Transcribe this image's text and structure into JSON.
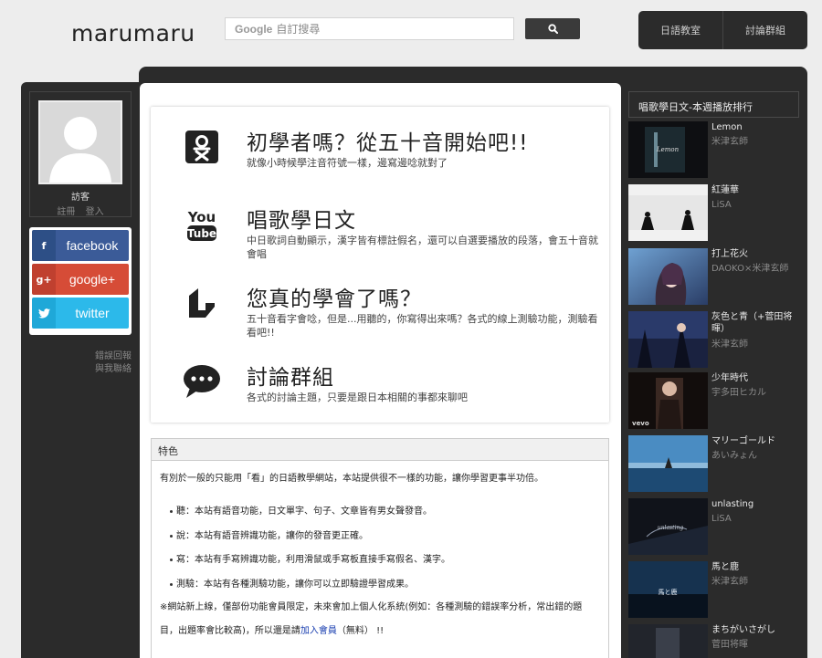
{
  "header": {
    "logo": "marumaru",
    "search_prefix": "Google",
    "search_placeholder": "自訂搜尋",
    "nav": [
      "日語教室",
      "討論群組"
    ]
  },
  "user": {
    "name": "訪客",
    "register": "註冊",
    "login": "登入"
  },
  "social": {
    "facebook": {
      "icon": "f",
      "label": "facebook"
    },
    "google": {
      "icon": "g+",
      "label": "google+"
    },
    "twitter": {
      "icon": "bird",
      "label": "twitter"
    }
  },
  "misc_links": [
    "錯誤回報",
    "與我聯絡"
  ],
  "features": [
    {
      "icon": "kana-icon",
      "title": "初學者嗎？從五十音開始吧!!",
      "desc": "就像小時候學注音符號一樣，邊寫邊唸就對了"
    },
    {
      "icon": "youtube-icon",
      "title": "唱歌學日文",
      "desc": "中日歌詞自動顯示，漢字皆有標註假名，還可以自選要播放的段落，會五十音就會唱"
    },
    {
      "icon": "quiz-icon",
      "title": "您真的學會了嗎？",
      "desc": "五十音看字會唸，但是...用聽的，你寫得出來嗎？各式的線上測驗功能，測驗看看吧!!"
    },
    {
      "icon": "chat-icon",
      "title": "討論群組",
      "desc": "各式的討論主題，只要是跟日本相關的事都來聊吧"
    }
  ],
  "panel": {
    "title": "特色",
    "intro": "有別於一般的只能用「看」的日語教學網站，本站提供很不一樣的功能，讓你學習更事半功倍。",
    "items": [
      "聽：本站有語音功能，日文單字、句子、文章皆有男女聲發音。",
      "說：本站有語音辨識功能，讓你的發音更正確。",
      "寫：本站有手寫辨識功能，利用滑鼠或手寫板直接手寫假名、漢字。",
      "測驗：本站有各種測驗功能，讓你可以立即驗證學習成果。"
    ],
    "note_a": "※網站新上線，僅部份功能會員限定，未來會加上個人化系統(例如：各種測驗的錯誤率分析，常出錯的題目，出題率會比較高)，所以還是請",
    "note_link": "加入會員",
    "note_b": "（無料） !!"
  },
  "ranking": {
    "title": "唱歌學日文-本週播放排行",
    "songs": [
      {
        "title": "Lemon",
        "artist": "米津玄師",
        "thumb_text": "Lemon"
      },
      {
        "title": "紅蓮華",
        "artist": "LiSA",
        "thumb_text": ""
      },
      {
        "title": "打上花火",
        "artist": "DAOKO×米津玄師",
        "thumb_text": ""
      },
      {
        "title": "灰色と青（+菅田将暉）",
        "artist": "米津玄師",
        "thumb_text": ""
      },
      {
        "title": "少年時代",
        "artist": "宇多田ヒカル",
        "thumb_text": "vevo"
      },
      {
        "title": "マリーゴールド",
        "artist": "あいみょん",
        "thumb_text": ""
      },
      {
        "title": "unlasting",
        "artist": "LiSA",
        "thumb_text": "unlasting"
      },
      {
        "title": "馬と鹿",
        "artist": "米津玄師",
        "thumb_text": "馬と鹿"
      },
      {
        "title": "まちがいさがし",
        "artist": "菅田将暉",
        "thumb_text": ""
      }
    ]
  }
}
